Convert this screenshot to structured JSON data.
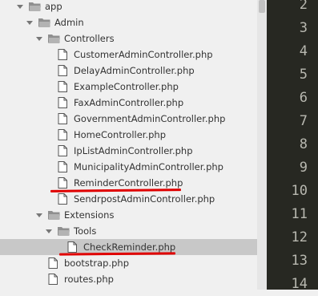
{
  "tree": {
    "items": [
      {
        "label": "app",
        "type": "folder",
        "expanded": true
      },
      {
        "label": "Admin",
        "type": "folder",
        "expanded": true
      },
      {
        "label": "Controllers",
        "type": "folder",
        "expanded": true
      },
      {
        "label": "CustomerAdminController.php",
        "type": "file"
      },
      {
        "label": "DelayAdminController.php",
        "type": "file"
      },
      {
        "label": "ExampleController.php",
        "type": "file"
      },
      {
        "label": "FaxAdminController.php",
        "type": "file"
      },
      {
        "label": "GovernmentAdminController.php",
        "type": "file"
      },
      {
        "label": "HomeController.php",
        "type": "file"
      },
      {
        "label": "IpListAdminController.php",
        "type": "file"
      },
      {
        "label": "MunicipalityAdminController.php",
        "type": "file"
      },
      {
        "label": "ReminderController.php",
        "type": "file",
        "annotated": true
      },
      {
        "label": "SendrpostAdminController.php",
        "type": "file"
      },
      {
        "label": "Extensions",
        "type": "folder",
        "expanded": true
      },
      {
        "label": "Tools",
        "type": "folder",
        "expanded": true
      },
      {
        "label": "CheckReminder.php",
        "type": "file",
        "selected": true,
        "annotated": true
      },
      {
        "label": "bootstrap.php",
        "type": "file"
      },
      {
        "label": "routes.php",
        "type": "file"
      }
    ]
  },
  "editor": {
    "line_numbers": [
      "2",
      "3",
      "4",
      "5",
      "6",
      "7",
      "8",
      "9",
      "10",
      "11",
      "12",
      "13",
      "14"
    ]
  },
  "colors": {
    "annotation": "#e00000",
    "editor_bg": "#272822",
    "sidebar_bg": "#f0f0f0",
    "selection": "#c8c8c8"
  }
}
